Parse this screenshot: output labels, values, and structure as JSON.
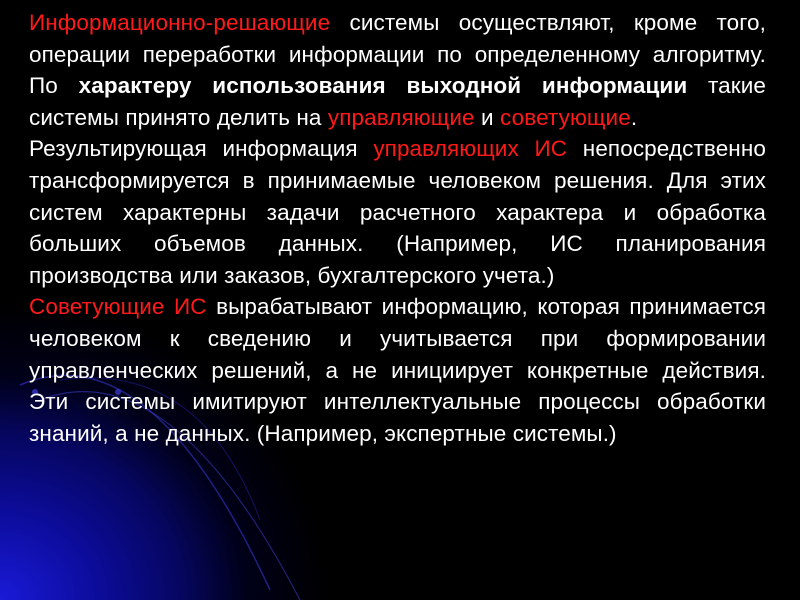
{
  "slide": {
    "colors": {
      "background": "#000000",
      "text": "#ffffff",
      "accent_red": "#ff1a1a",
      "glow_blue": "#1a1ad8"
    },
    "paragraphs": [
      {
        "segments": [
          {
            "text": "Информационно-решающие",
            "style": "red"
          },
          {
            "text": " системы осуществляют, кроме того, операции переработки информации по определенному алгоритму. По ",
            "style": "normal"
          },
          {
            "text": "характеру использования выходной информации",
            "style": "bold"
          },
          {
            "text": " такие системы принято делить на ",
            "style": "normal"
          },
          {
            "text": "управляющие",
            "style": "red"
          },
          {
            "text": " и ",
            "style": "normal"
          },
          {
            "text": "советующие",
            "style": "red"
          },
          {
            "text": ".",
            "style": "normal"
          }
        ]
      },
      {
        "segments": [
          {
            "text": "Результирующая информация ",
            "style": "normal"
          },
          {
            "text": "управляющих ИС",
            "style": "red"
          },
          {
            "text": " непосредственно трансформируется в принимаемые человеком решения. Для этих систем характерны задачи расчетного характера и обработка больших объемов данных. (Например, ИС планирования производства или заказов, бухгалтерского учета.)",
            "style": "normal"
          }
        ]
      },
      {
        "segments": [
          {
            "text": "Советующие ИС",
            "style": "red"
          },
          {
            "text": " вырабатывают информацию, которая принимается человеком к сведению и учитывается при формировании управленческих решений, а не инициирует конкретные действия. Эти системы имитируют интеллектуальные процессы обработки знаний, а не данных. (Например, экспертные системы.)",
            "style": "normal"
          }
        ]
      }
    ]
  }
}
